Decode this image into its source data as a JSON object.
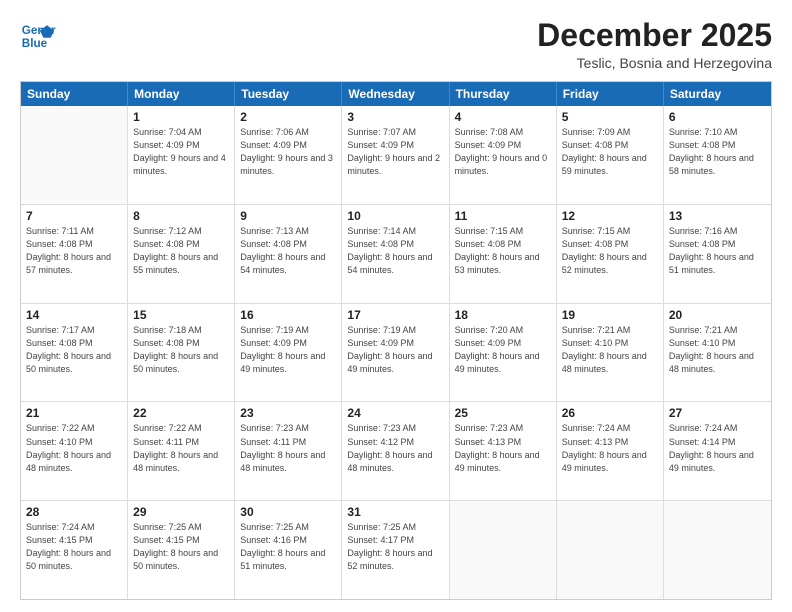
{
  "logo": {
    "line1": "General",
    "line2": "Blue"
  },
  "title": "December 2025",
  "subtitle": "Teslic, Bosnia and Herzegovina",
  "header_days": [
    "Sunday",
    "Monday",
    "Tuesday",
    "Wednesday",
    "Thursday",
    "Friday",
    "Saturday"
  ],
  "weeks": [
    [
      {
        "day": "",
        "sunrise": "",
        "sunset": "",
        "daylight": ""
      },
      {
        "day": "1",
        "sunrise": "Sunrise: 7:04 AM",
        "sunset": "Sunset: 4:09 PM",
        "daylight": "Daylight: 9 hours and 4 minutes."
      },
      {
        "day": "2",
        "sunrise": "Sunrise: 7:06 AM",
        "sunset": "Sunset: 4:09 PM",
        "daylight": "Daylight: 9 hours and 3 minutes."
      },
      {
        "day": "3",
        "sunrise": "Sunrise: 7:07 AM",
        "sunset": "Sunset: 4:09 PM",
        "daylight": "Daylight: 9 hours and 2 minutes."
      },
      {
        "day": "4",
        "sunrise": "Sunrise: 7:08 AM",
        "sunset": "Sunset: 4:09 PM",
        "daylight": "Daylight: 9 hours and 0 minutes."
      },
      {
        "day": "5",
        "sunrise": "Sunrise: 7:09 AM",
        "sunset": "Sunset: 4:08 PM",
        "daylight": "Daylight: 8 hours and 59 minutes."
      },
      {
        "day": "6",
        "sunrise": "Sunrise: 7:10 AM",
        "sunset": "Sunset: 4:08 PM",
        "daylight": "Daylight: 8 hours and 58 minutes."
      }
    ],
    [
      {
        "day": "7",
        "sunrise": "Sunrise: 7:11 AM",
        "sunset": "Sunset: 4:08 PM",
        "daylight": "Daylight: 8 hours and 57 minutes."
      },
      {
        "day": "8",
        "sunrise": "Sunrise: 7:12 AM",
        "sunset": "Sunset: 4:08 PM",
        "daylight": "Daylight: 8 hours and 55 minutes."
      },
      {
        "day": "9",
        "sunrise": "Sunrise: 7:13 AM",
        "sunset": "Sunset: 4:08 PM",
        "daylight": "Daylight: 8 hours and 54 minutes."
      },
      {
        "day": "10",
        "sunrise": "Sunrise: 7:14 AM",
        "sunset": "Sunset: 4:08 PM",
        "daylight": "Daylight: 8 hours and 54 minutes."
      },
      {
        "day": "11",
        "sunrise": "Sunrise: 7:15 AM",
        "sunset": "Sunset: 4:08 PM",
        "daylight": "Daylight: 8 hours and 53 minutes."
      },
      {
        "day": "12",
        "sunrise": "Sunrise: 7:15 AM",
        "sunset": "Sunset: 4:08 PM",
        "daylight": "Daylight: 8 hours and 52 minutes."
      },
      {
        "day": "13",
        "sunrise": "Sunrise: 7:16 AM",
        "sunset": "Sunset: 4:08 PM",
        "daylight": "Daylight: 8 hours and 51 minutes."
      }
    ],
    [
      {
        "day": "14",
        "sunrise": "Sunrise: 7:17 AM",
        "sunset": "Sunset: 4:08 PM",
        "daylight": "Daylight: 8 hours and 50 minutes."
      },
      {
        "day": "15",
        "sunrise": "Sunrise: 7:18 AM",
        "sunset": "Sunset: 4:08 PM",
        "daylight": "Daylight: 8 hours and 50 minutes."
      },
      {
        "day": "16",
        "sunrise": "Sunrise: 7:19 AM",
        "sunset": "Sunset: 4:09 PM",
        "daylight": "Daylight: 8 hours and 49 minutes."
      },
      {
        "day": "17",
        "sunrise": "Sunrise: 7:19 AM",
        "sunset": "Sunset: 4:09 PM",
        "daylight": "Daylight: 8 hours and 49 minutes."
      },
      {
        "day": "18",
        "sunrise": "Sunrise: 7:20 AM",
        "sunset": "Sunset: 4:09 PM",
        "daylight": "Daylight: 8 hours and 49 minutes."
      },
      {
        "day": "19",
        "sunrise": "Sunrise: 7:21 AM",
        "sunset": "Sunset: 4:10 PM",
        "daylight": "Daylight: 8 hours and 48 minutes."
      },
      {
        "day": "20",
        "sunrise": "Sunrise: 7:21 AM",
        "sunset": "Sunset: 4:10 PM",
        "daylight": "Daylight: 8 hours and 48 minutes."
      }
    ],
    [
      {
        "day": "21",
        "sunrise": "Sunrise: 7:22 AM",
        "sunset": "Sunset: 4:10 PM",
        "daylight": "Daylight: 8 hours and 48 minutes."
      },
      {
        "day": "22",
        "sunrise": "Sunrise: 7:22 AM",
        "sunset": "Sunset: 4:11 PM",
        "daylight": "Daylight: 8 hours and 48 minutes."
      },
      {
        "day": "23",
        "sunrise": "Sunrise: 7:23 AM",
        "sunset": "Sunset: 4:11 PM",
        "daylight": "Daylight: 8 hours and 48 minutes."
      },
      {
        "day": "24",
        "sunrise": "Sunrise: 7:23 AM",
        "sunset": "Sunset: 4:12 PM",
        "daylight": "Daylight: 8 hours and 48 minutes."
      },
      {
        "day": "25",
        "sunrise": "Sunrise: 7:23 AM",
        "sunset": "Sunset: 4:13 PM",
        "daylight": "Daylight: 8 hours and 49 minutes."
      },
      {
        "day": "26",
        "sunrise": "Sunrise: 7:24 AM",
        "sunset": "Sunset: 4:13 PM",
        "daylight": "Daylight: 8 hours and 49 minutes."
      },
      {
        "day": "27",
        "sunrise": "Sunrise: 7:24 AM",
        "sunset": "Sunset: 4:14 PM",
        "daylight": "Daylight: 8 hours and 49 minutes."
      }
    ],
    [
      {
        "day": "28",
        "sunrise": "Sunrise: 7:24 AM",
        "sunset": "Sunset: 4:15 PM",
        "daylight": "Daylight: 8 hours and 50 minutes."
      },
      {
        "day": "29",
        "sunrise": "Sunrise: 7:25 AM",
        "sunset": "Sunset: 4:15 PM",
        "daylight": "Daylight: 8 hours and 50 minutes."
      },
      {
        "day": "30",
        "sunrise": "Sunrise: 7:25 AM",
        "sunset": "Sunset: 4:16 PM",
        "daylight": "Daylight: 8 hours and 51 minutes."
      },
      {
        "day": "31",
        "sunrise": "Sunrise: 7:25 AM",
        "sunset": "Sunset: 4:17 PM",
        "daylight": "Daylight: 8 hours and 52 minutes."
      },
      {
        "day": "",
        "sunrise": "",
        "sunset": "",
        "daylight": ""
      },
      {
        "day": "",
        "sunrise": "",
        "sunset": "",
        "daylight": ""
      },
      {
        "day": "",
        "sunrise": "",
        "sunset": "",
        "daylight": ""
      }
    ]
  ]
}
